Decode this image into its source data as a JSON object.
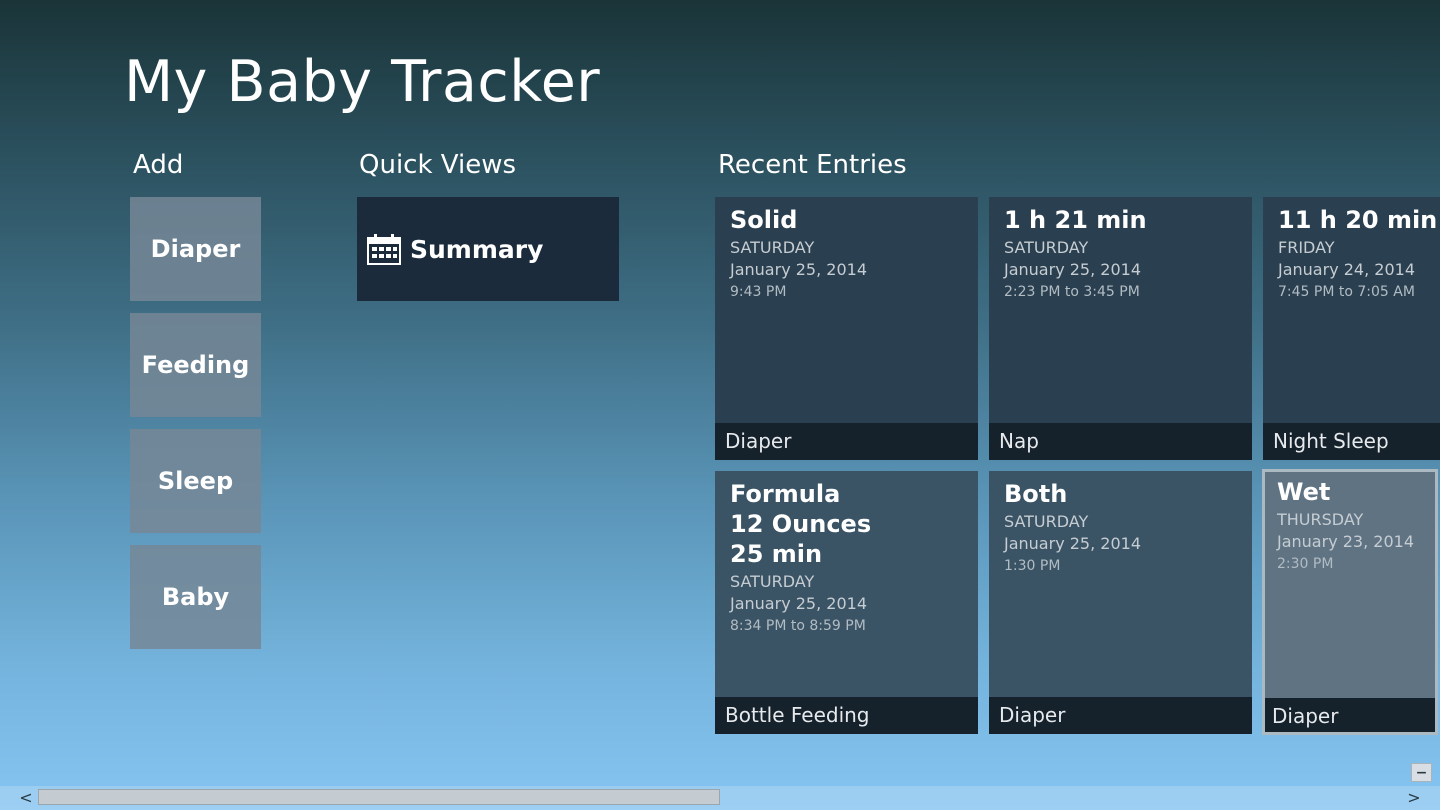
{
  "app": {
    "title": "My Baby Tracker"
  },
  "sections": {
    "add": "Add",
    "quick_views": "Quick Views",
    "recent_entries": "Recent Entries"
  },
  "add_tiles": [
    {
      "label": "Diaper"
    },
    {
      "label": "Feeding"
    },
    {
      "label": "Sleep"
    },
    {
      "label": "Baby"
    }
  ],
  "quick_views": {
    "summary": {
      "label": "Summary",
      "icon": "calendar-icon"
    }
  },
  "entries": [
    {
      "title_lines": [
        "Solid"
      ],
      "day": "SATURDAY",
      "date": "January 25, 2014",
      "time": "9:43 PM",
      "category": "Diaper"
    },
    {
      "title_lines": [
        "1 h 21 min"
      ],
      "day": "SATURDAY",
      "date": "January 25, 2014",
      "time": "2:23 PM to 3:45 PM",
      "category": "Nap"
    },
    {
      "title_lines": [
        "11 h 20 min"
      ],
      "day": "FRIDAY",
      "date": "January 24, 2014",
      "time": "7:45 PM to 7:05 AM",
      "category": "Night Sleep"
    },
    {
      "title_lines": [
        "Formula",
        "12 Ounces",
        "25 min"
      ],
      "day": "SATURDAY",
      "date": "January 25, 2014",
      "time": "8:34 PM to 8:59 PM",
      "category": "Bottle Feeding"
    },
    {
      "title_lines": [
        "Both"
      ],
      "day": "SATURDAY",
      "date": "January 25, 2014",
      "time": "1:30 PM",
      "category": "Diaper"
    },
    {
      "title_lines": [
        "Wet"
      ],
      "day": "THURSDAY",
      "date": "January 23, 2014",
      "time": "2:30 PM",
      "category": "Diaper"
    }
  ],
  "scrollbar": {
    "left_arrow": "<",
    "right_arrow": ">",
    "zoom_label": "−",
    "scroll_fraction": 0.49
  },
  "colors": {
    "add_tile": "#76879a",
    "summary_tile": "#1c2b3b",
    "entry_dark": "#2a3f4f",
    "entry_mid": "#3a5466",
    "entry_selected": "#5f7383",
    "entry_footer": "#15212b"
  }
}
